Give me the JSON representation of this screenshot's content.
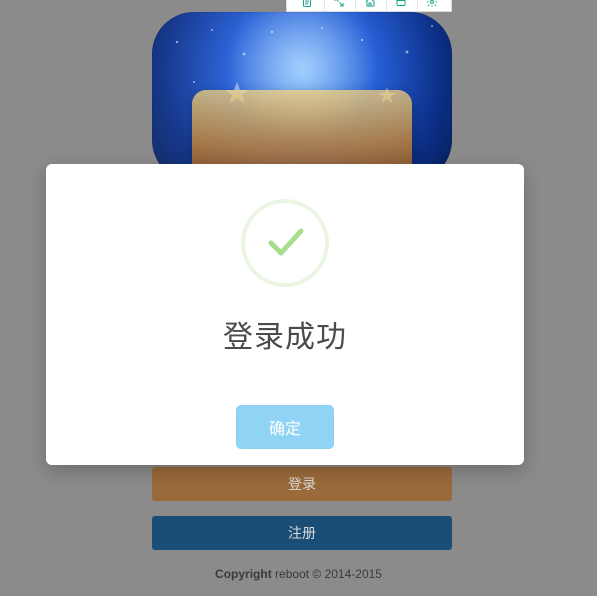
{
  "toolbar": {
    "icons": [
      "document-icon",
      "expand-icon",
      "home-icon",
      "window-icon",
      "settings-icon"
    ]
  },
  "background": {
    "login_button": "登录",
    "register_button": "注册",
    "footer": {
      "copyright_label": "Copyright",
      "text": "reboot © 2014-2015"
    }
  },
  "dialog": {
    "title": "登录成功",
    "confirm_button": "确定",
    "success_icon": "checkmark-icon"
  },
  "colors": {
    "overlay": "#8b8b8b",
    "confirm": "#8fd4f4",
    "success": "#a7dd8b",
    "login": "#9b6a3a",
    "register": "#1b4e77"
  }
}
